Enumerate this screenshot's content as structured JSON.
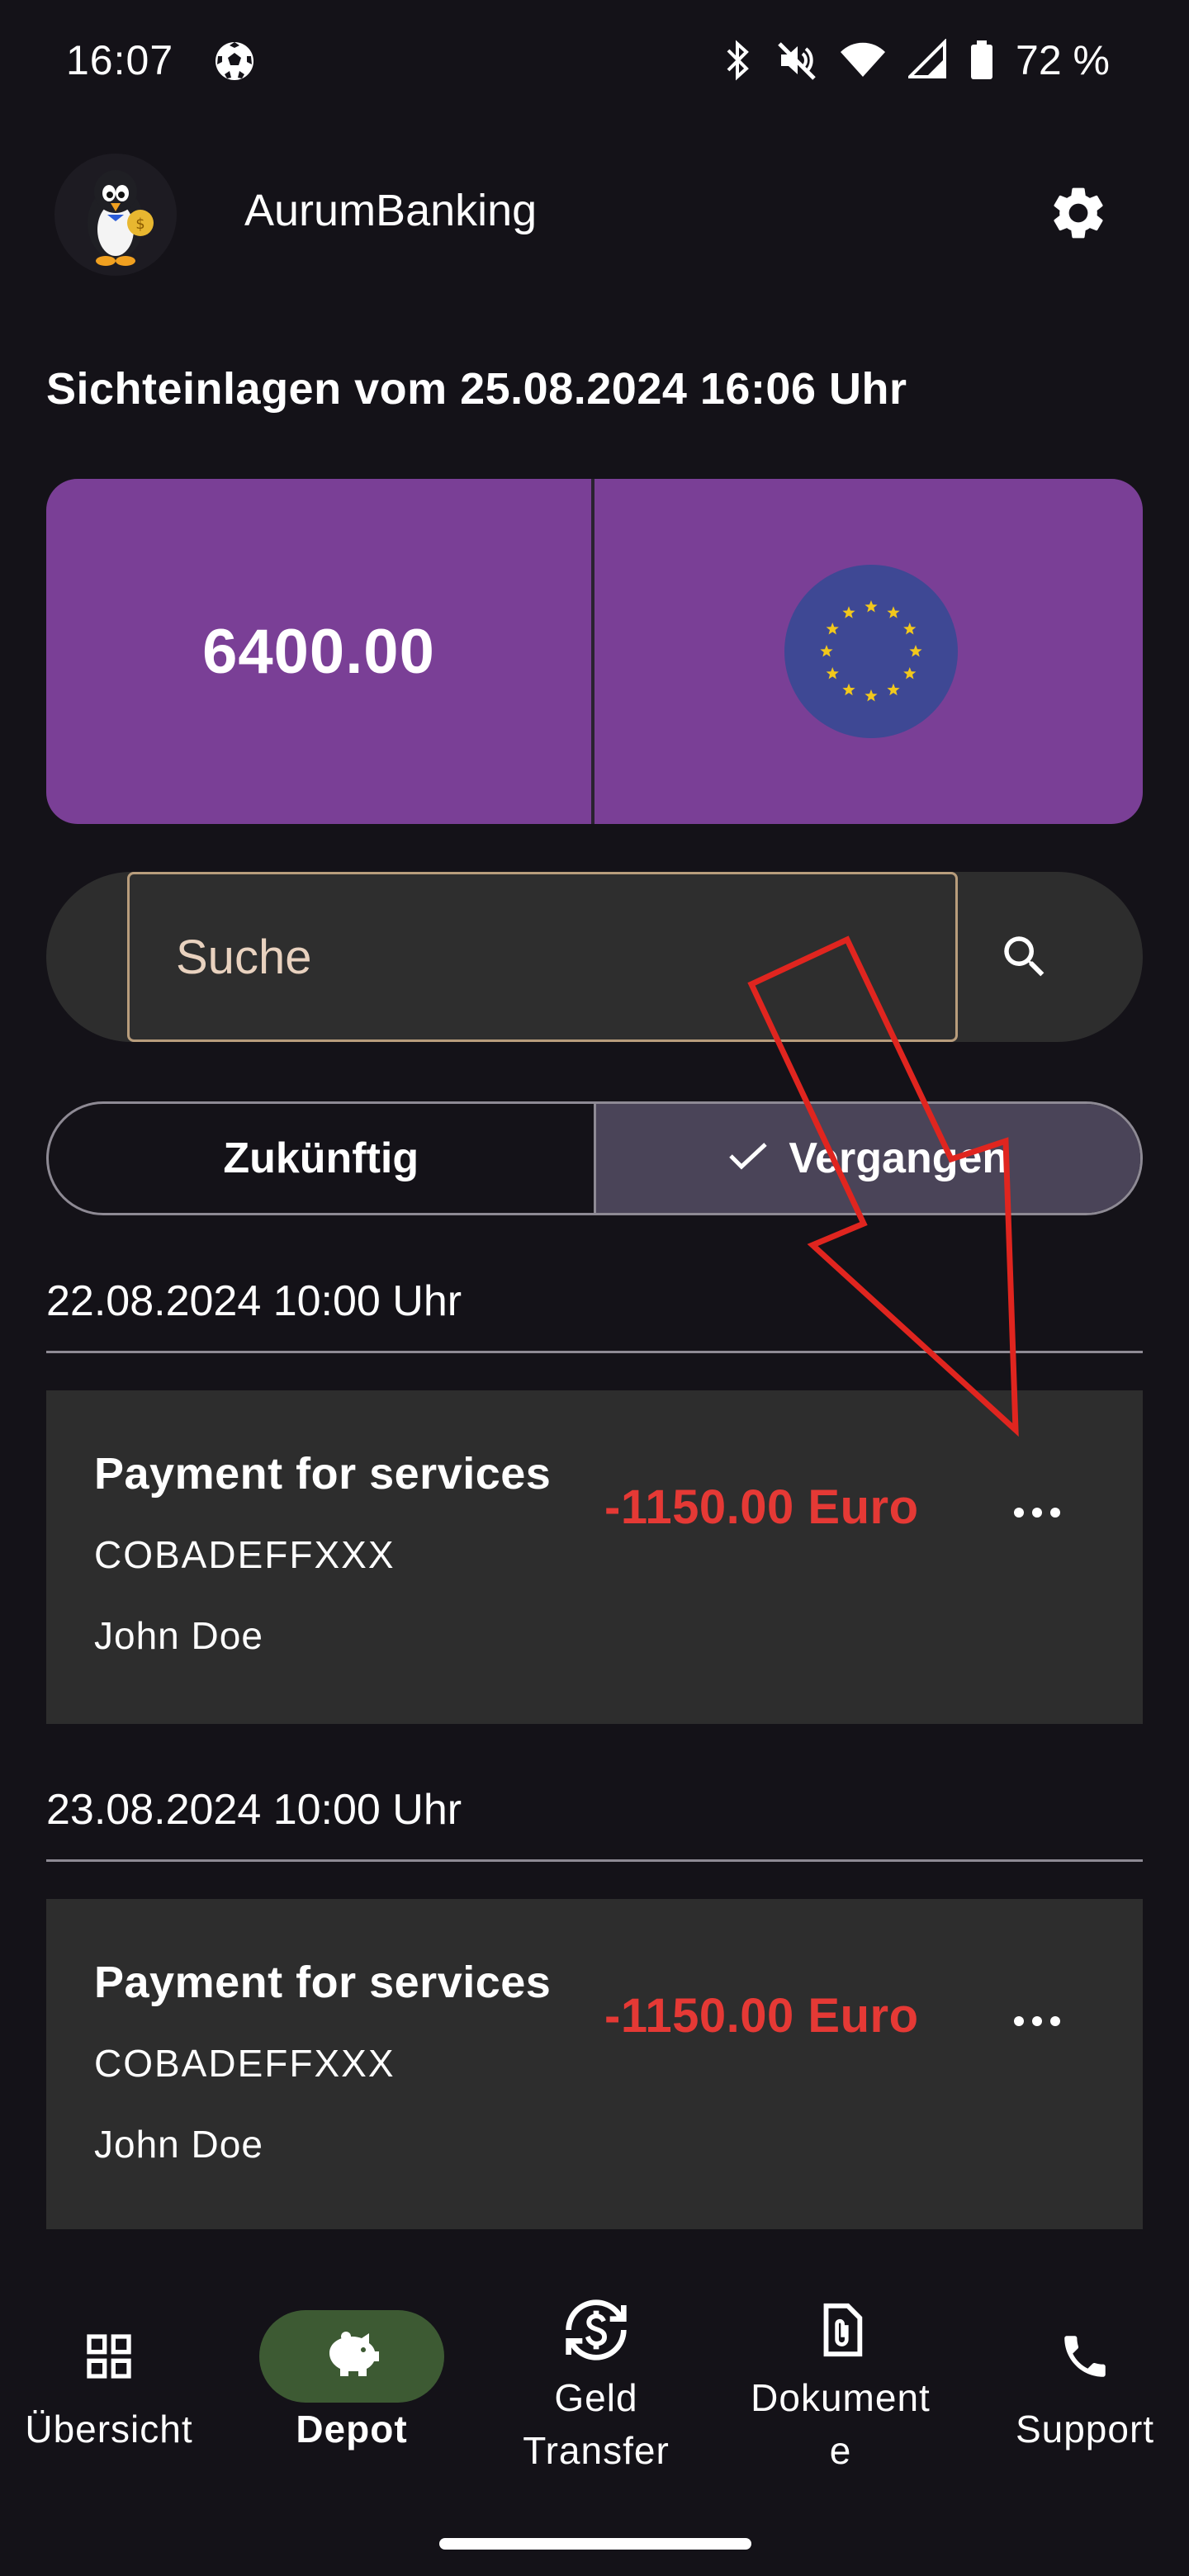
{
  "status_bar": {
    "time": "16:07",
    "battery": "72 %"
  },
  "header": {
    "app_title": "AurumBanking"
  },
  "heading": "Sichteinlagen vom 25.08.2024 16:06 Uhr",
  "balance": {
    "amount": "6400.00",
    "currency_icon": "eu-flag-icon"
  },
  "search": {
    "placeholder": "Suche"
  },
  "filter": {
    "options": [
      "Zukünftig",
      "Vergangen"
    ],
    "selected": "Vergangen"
  },
  "transactions": [
    {
      "date": "22.08.2024 10:00 Uhr",
      "title": "Payment for services",
      "bic": "COBADEFFXXX",
      "name": "John Doe",
      "amount": "-1150.00 Euro"
    },
    {
      "date": "23.08.2024 10:00 Uhr",
      "title": "Payment for services",
      "bic": "COBADEFFXXX",
      "name": "John Doe",
      "amount": "-1150.00 Euro"
    }
  ],
  "bottom_nav": {
    "items": [
      {
        "label": "Übersicht",
        "icon": "grid-icon"
      },
      {
        "label": "Depot",
        "icon": "piggy-bank-icon"
      },
      {
        "label": "Geld\nTransfer",
        "icon": "currency-exchange-icon"
      },
      {
        "label": "Dokument\ne",
        "icon": "document-icon"
      },
      {
        "label": "Support",
        "icon": "phone-icon"
      }
    ],
    "active": "Depot"
  },
  "colors": {
    "background": "#141218",
    "balance_card": "#7a3f96",
    "negative_amount": "#e53935",
    "active_nav": "#3d5a33",
    "annotation_arrow": "#e0251f"
  }
}
